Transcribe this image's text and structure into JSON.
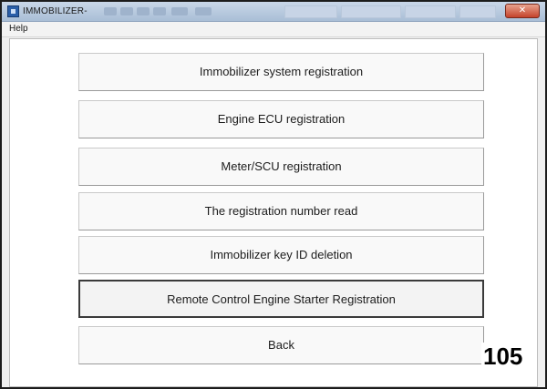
{
  "window": {
    "title": "IMMOBILIZER-",
    "close_label": "✕"
  },
  "menubar": {
    "items": [
      "Help"
    ]
  },
  "buttons": [
    {
      "label": "Immobilizer system registration"
    },
    {
      "label": "Engine ECU registration"
    },
    {
      "label": "Meter/SCU registration"
    },
    {
      "label": "The registration number read"
    },
    {
      "label": "Immobilizer key ID deletion"
    },
    {
      "label": "Remote Control Engine Starter Registration"
    },
    {
      "label": "Back"
    }
  ],
  "page_number": "105",
  "colors": {
    "titlebar": "#b3c6de",
    "close_button": "#c4432b",
    "button_face": "#f9f9f9"
  }
}
